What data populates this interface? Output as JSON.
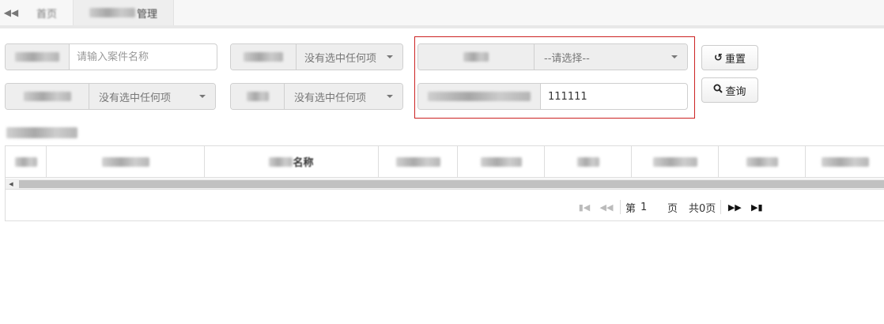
{
  "tabs": {
    "back_icon": "double-chevron-left-icon",
    "home_label": "首页",
    "active_label": "管理"
  },
  "filters": {
    "case_name": {
      "placeholder": "请输入案件名称"
    },
    "select_a": {
      "value": "没有选中任何项"
    },
    "select_b": {
      "value": "--请选择--"
    },
    "select_c": {
      "value": "没有选中任何项"
    },
    "select_d": {
      "value": "没有选中任何项"
    },
    "text_e": {
      "value": "111111"
    }
  },
  "buttons": {
    "reset_label": "重置",
    "query_label": "查询",
    "reset_icon": "undo-icon",
    "query_icon": "search-icon"
  },
  "table": {
    "headers": [
      "",
      "",
      "名称",
      "",
      "",
      "",
      "",
      "",
      ""
    ]
  },
  "pagination": {
    "page_prefix": "第",
    "page_input": "1",
    "page_suffix": "页",
    "total_text": "共0页"
  },
  "colors": {
    "highlight_border": "#cc2222",
    "addon_bg": "#eeeeee"
  }
}
